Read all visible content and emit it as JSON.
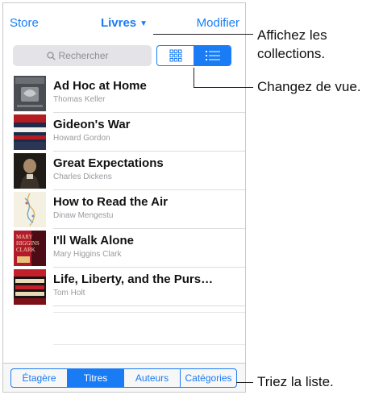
{
  "navbar": {
    "store_label": "Store",
    "title": "Livres",
    "edit_label": "Modifier"
  },
  "search": {
    "placeholder": "Rechercher"
  },
  "view_toggle": {
    "options": [
      "grid-icon",
      "list-icon"
    ],
    "selected": "list"
  },
  "books": [
    {
      "title": "Ad Hoc at Home",
      "author": "Thomas Keller"
    },
    {
      "title": "Gideon's War",
      "author": "Howard Gordon"
    },
    {
      "title": "Great Expectations",
      "author": "Charles Dickens"
    },
    {
      "title": "How to Read the Air",
      "author": "Dinaw Mengestu"
    },
    {
      "title": "I'll Walk Alone",
      "author": "Mary Higgins Clark"
    },
    {
      "title": "Life, Liberty, and the Purs…",
      "author": "Tom Holt"
    }
  ],
  "cover_text": {
    "mary_line1": "MARY",
    "mary_line2": "HIGGINS",
    "mary_line3": "CLARK"
  },
  "sort_tabs": [
    {
      "label": "Étagère"
    },
    {
      "label": "Titres"
    },
    {
      "label": "Auteurs"
    },
    {
      "label": "Catégories"
    }
  ],
  "sort_selected": "Titres",
  "callouts": {
    "collections_line1": "Affichez les",
    "collections_line2": "collections.",
    "view": "Changez de vue.",
    "sort": "Triez la liste."
  },
  "colors": {
    "accent": "#1a7cf5",
    "author_gray": "#9a9aa0"
  }
}
